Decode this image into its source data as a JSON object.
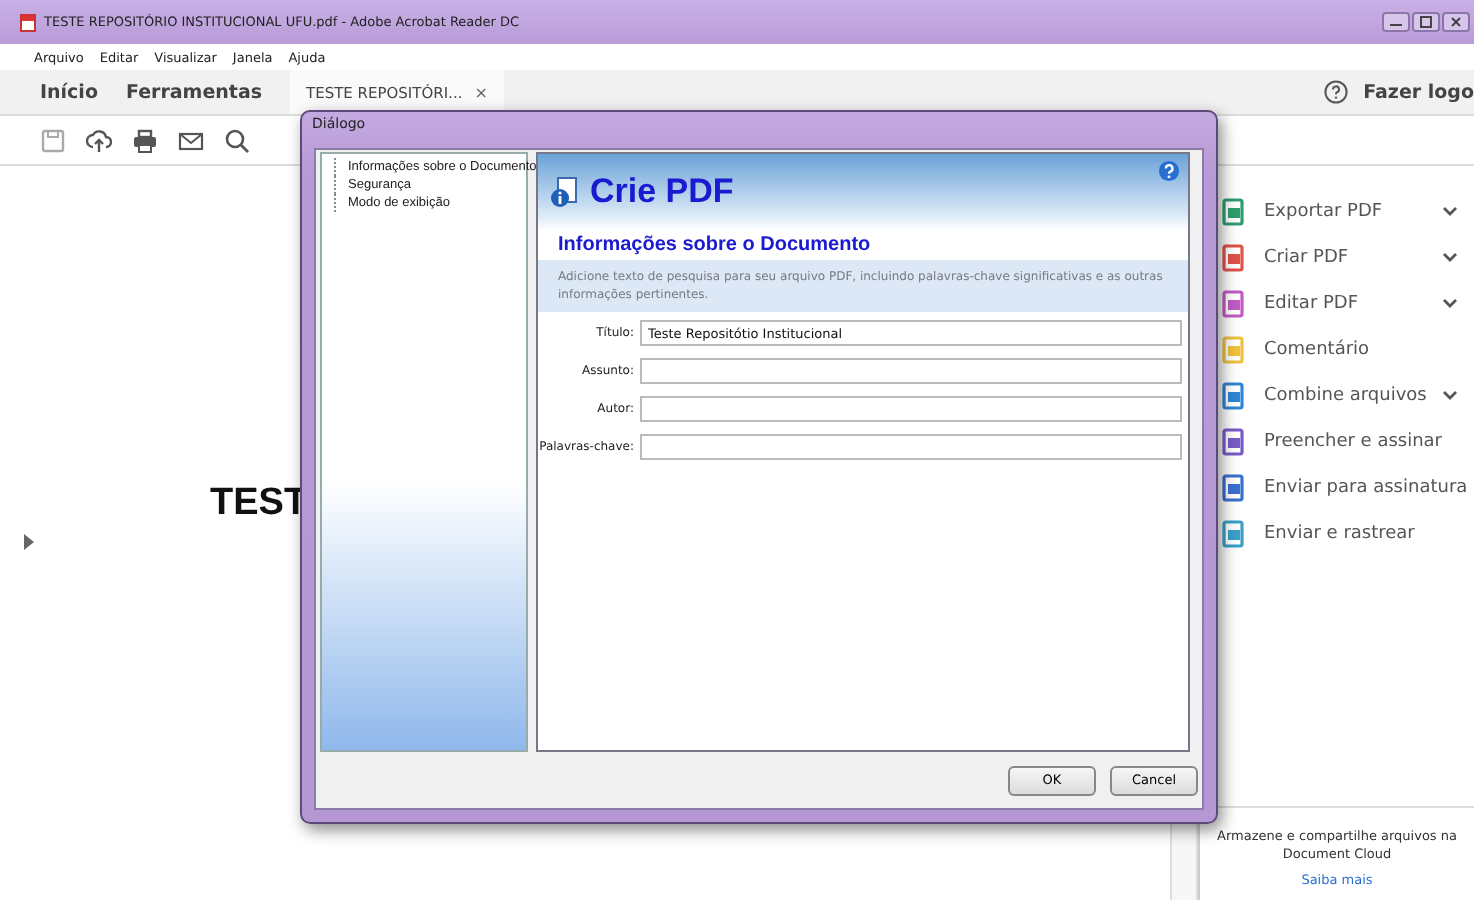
{
  "window": {
    "title": "TESTE REPOSITÓRIO INSTITUCIONAL UFU.pdf - Adobe Acrobat Reader DC"
  },
  "menu": [
    "Arquivo",
    "Editar",
    "Visualizar",
    "Janela",
    "Ajuda"
  ],
  "tabs": [
    {
      "label": "Início",
      "kind": "nav"
    },
    {
      "label": "Ferramentas",
      "kind": "nav"
    },
    {
      "label": "TESTE REPOSITÓRI...",
      "kind": "doc",
      "close": "×"
    }
  ],
  "account": {
    "label": "Fazer logo"
  },
  "document": {
    "text": "TEST"
  },
  "tools": [
    {
      "label": "Exportar PDF",
      "color": "#2e9e6e",
      "expandable": true
    },
    {
      "label": "Criar PDF",
      "color": "#e0524a",
      "expandable": true
    },
    {
      "label": "Editar PDF",
      "color": "#c25bc4",
      "expandable": true
    },
    {
      "label": "Comentário",
      "color": "#f0c23c",
      "expandable": false
    },
    {
      "label": "Combine arquivos",
      "color": "#2f86d6",
      "expandable": true
    },
    {
      "label": "Preencher e assinar",
      "color": "#7a5bc8",
      "expandable": false
    },
    {
      "label": "Enviar para assinatura",
      "color": "#3b6fd0",
      "expandable": false
    },
    {
      "label": "Enviar e rastrear",
      "color": "#3aa0c8",
      "expandable": false
    }
  ],
  "cloud": {
    "text": "Armazene e compartilhe arquivos na Document Cloud",
    "link": "Saiba mais"
  },
  "dialog": {
    "title": "Diálogo",
    "tree": [
      "Informações sobre o Documento",
      "Segurança",
      "Modo de exibição"
    ],
    "heading": "Crie PDF",
    "section_title": "Informações sobre o Documento",
    "description": "Adicione texto de pesquisa para seu arquivo PDF, incluindo palavras-chave significativas  e as outras informações pertinentes.",
    "fields": [
      {
        "label": "Título:",
        "value": "Teste Repositótio Institucional"
      },
      {
        "label": "Assunto:"
      },
      {
        "label": "Autor:"
      },
      {
        "label": "Palavras-chave:"
      }
    ],
    "buttons": [
      "OK",
      "Cancel"
    ]
  }
}
